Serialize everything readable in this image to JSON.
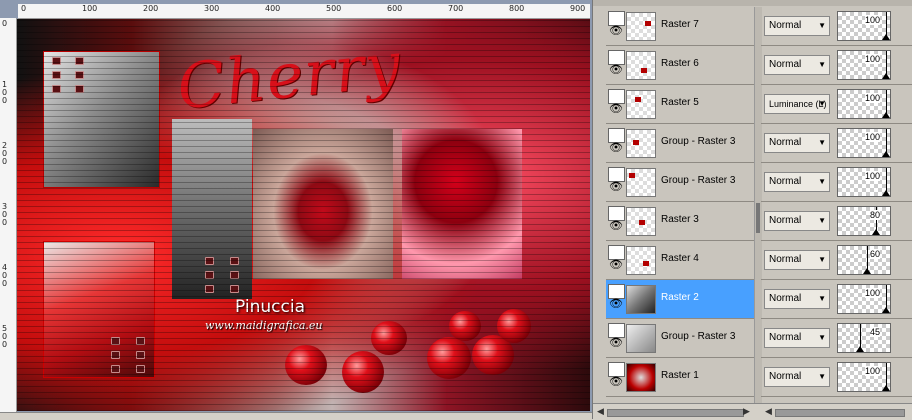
{
  "ruler": {
    "horizontal_ticks": [
      "0",
      "100",
      "200",
      "300",
      "400",
      "500",
      "600",
      "700",
      "800",
      "900"
    ],
    "vertical_ticks": [
      "0",
      "1 0 0",
      "2 0 0",
      "3 0 0",
      "4 0 0",
      "5 0 0"
    ]
  },
  "artwork": {
    "title": "Cherry",
    "author": "Pinuccia",
    "website": "www.maidigrafica.eu"
  },
  "layers": [
    {
      "name": "Raster 7",
      "blend": "Normal",
      "opacity": "100",
      "selected": false
    },
    {
      "name": "Raster 6",
      "blend": "Normal",
      "opacity": "100",
      "selected": false
    },
    {
      "name": "Raster 5",
      "blend": "Luminance (L)",
      "opacity": "100",
      "selected": false
    },
    {
      "name": "Group - Raster 3",
      "blend": "Normal",
      "opacity": "100",
      "selected": false
    },
    {
      "name": "Group - Raster 3",
      "blend": "Normal",
      "opacity": "100",
      "selected": false
    },
    {
      "name": "Raster 3",
      "blend": "Normal",
      "opacity": "80",
      "selected": false
    },
    {
      "name": "Raster 4",
      "blend": "Normal",
      "opacity": "60",
      "selected": false
    },
    {
      "name": "Raster 2",
      "blend": "Normal",
      "opacity": "100",
      "selected": true
    },
    {
      "name": "Group - Raster 3",
      "blend": "Normal",
      "opacity": "45",
      "selected": false
    },
    {
      "name": "Raster 1",
      "blend": "Normal",
      "opacity": "100",
      "selected": false
    }
  ],
  "colors": {
    "selected_row": "#48a0ff",
    "accent_red": "#d8101a"
  },
  "icons": {
    "visibility": "eye-icon",
    "dropdown": "chevron-down-icon"
  }
}
